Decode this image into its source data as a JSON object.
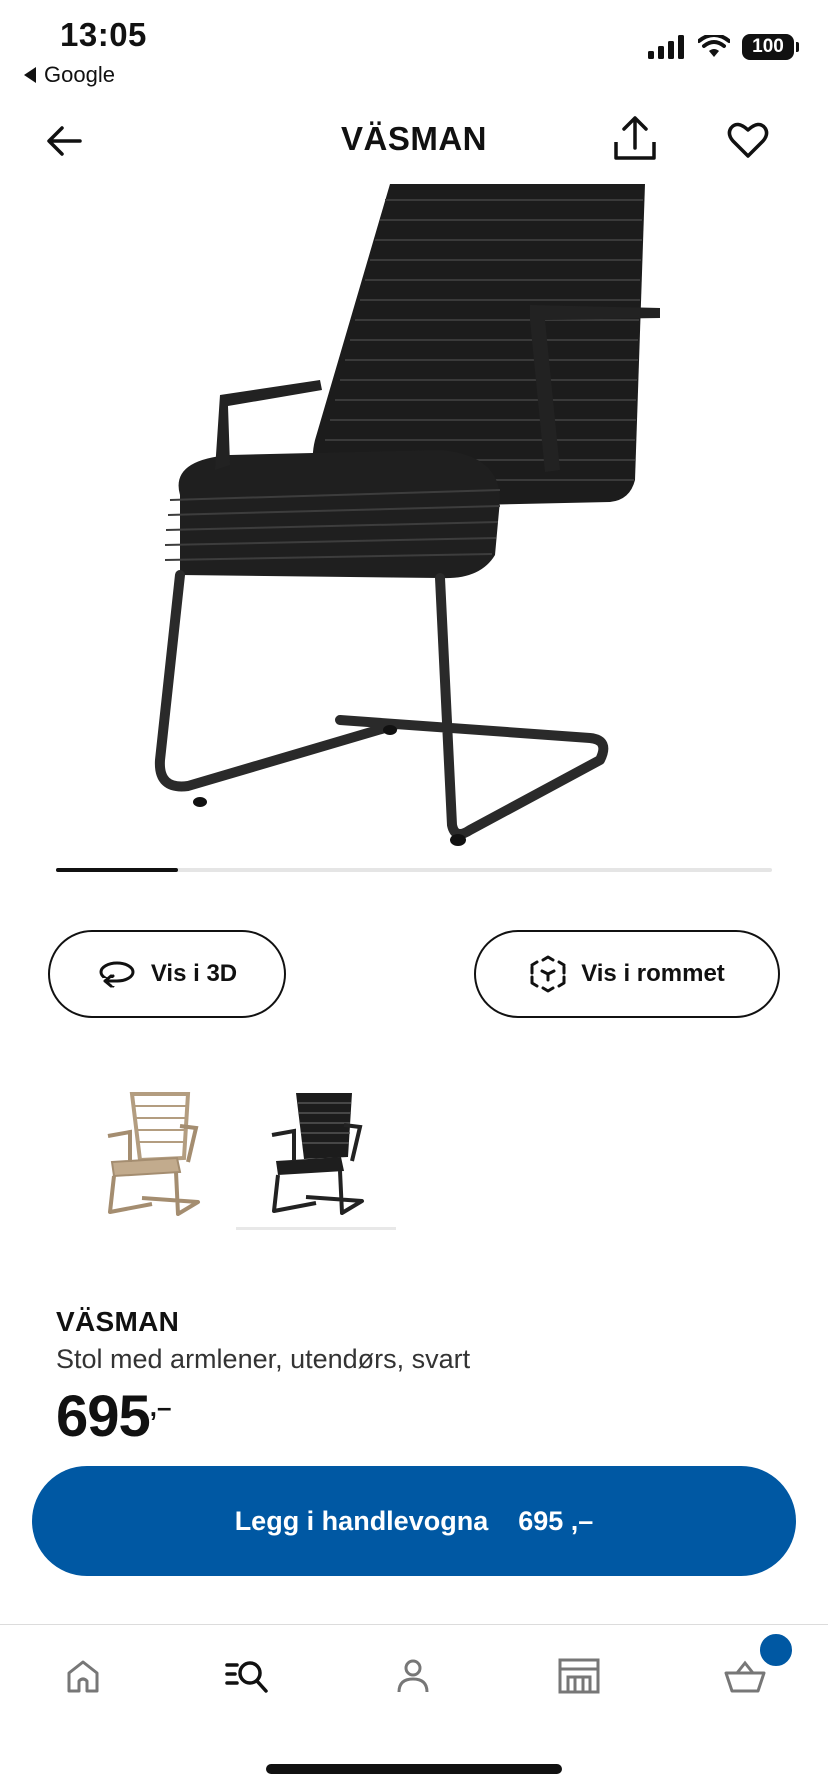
{
  "status_bar": {
    "time": "13:05",
    "back_app": "Google",
    "battery": "100",
    "icons": [
      "signal-icon",
      "wifi-icon",
      "battery-icon"
    ]
  },
  "header": {
    "title": "VÄSMAN",
    "icons": [
      "back-arrow-icon",
      "share-icon",
      "heart-icon"
    ]
  },
  "gallery": {
    "progress": 0.17
  },
  "view_buttons": {
    "view_3d": "Vis i 3D",
    "view_room": "Vis i rommet"
  },
  "variants": [
    {
      "color": "beige"
    },
    {
      "color": "black"
    }
  ],
  "product": {
    "name": "VÄSMAN",
    "description": "Stol med armlener, utendørs, svart",
    "price": "695",
    "price_suffix": ",–"
  },
  "cta": {
    "label": "Legg i handlevogna",
    "price": "695 ,–"
  },
  "nav": {
    "items": [
      "home-icon",
      "search-icon",
      "profile-icon",
      "store-icon",
      "cart-icon"
    ],
    "active": "search"
  },
  "colors": {
    "brand_blue": "#0058a3",
    "text": "#111111",
    "beige": "#b39d80"
  }
}
